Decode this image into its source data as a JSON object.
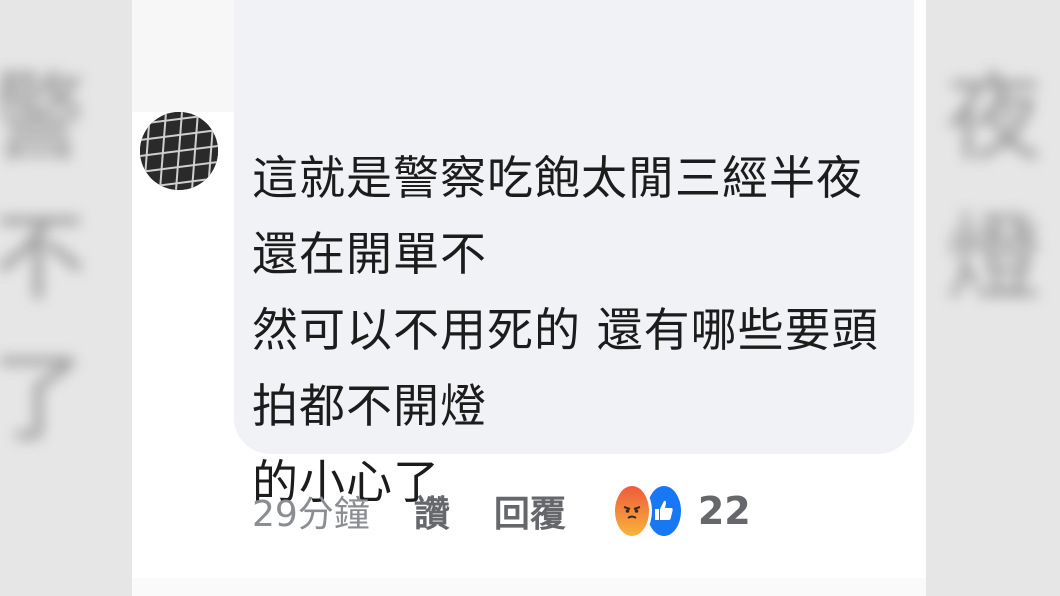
{
  "comment": {
    "text_line1": "這就是警察吃飽太閒三經半夜還在開單不",
    "text_line2": "然可以不用死的 還有哪些要頭拍都不開燈",
    "text_line3": "的小心了"
  },
  "actions": {
    "timestamp": "29分鐘",
    "like_label": "讚",
    "reply_label": "回覆"
  },
  "reactions": {
    "icons": [
      "angry-icon",
      "like-icon"
    ],
    "count": "22",
    "colors": {
      "angry_top": "#ef5b3d",
      "angry_bottom": "#f7b43a",
      "like": "#1877f2"
    }
  }
}
